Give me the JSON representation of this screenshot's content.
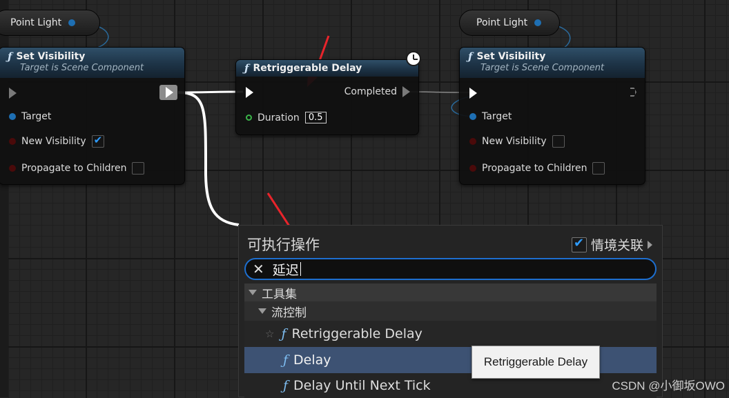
{
  "graph": {
    "var_left": {
      "label": "Point Light"
    },
    "var_right": {
      "label": "Point Light"
    },
    "node_left": {
      "title": "Set Visibility",
      "subtitle": "Target is Scene Component",
      "pins": {
        "target": "Target",
        "new_visibility": "New Visibility",
        "propagate": "Propagate to Children"
      },
      "new_visibility_checked": true,
      "propagate_checked": false
    },
    "node_delay": {
      "title": "Retriggerable Delay",
      "completed": "Completed",
      "duration_label": "Duration",
      "duration_value": "0.5"
    },
    "node_right": {
      "title": "Set Visibility",
      "subtitle": "Target is Scene Component",
      "pins": {
        "target": "Target",
        "new_visibility": "New Visibility",
        "propagate": "Propagate to Children"
      },
      "new_visibility_checked": false,
      "propagate_checked": false
    }
  },
  "action_menu": {
    "title": "可执行操作",
    "context_label": "情境关联",
    "context_checked": true,
    "search_value": "延迟",
    "categories": [
      {
        "label": "工具集"
      },
      {
        "label": "流控制"
      }
    ],
    "items": [
      {
        "label": "Retriggerable Delay",
        "favorite_icon": "star-outline-icon",
        "selected": false
      },
      {
        "label": "Delay",
        "selected": true
      },
      {
        "label": "Delay Until Next Tick",
        "selected": false
      }
    ]
  },
  "tooltip": {
    "text": "Retriggerable Delay"
  },
  "watermark": {
    "text": "CSDN @小御坂OWO"
  },
  "colors": {
    "accent": "#1d6fd0",
    "selected_row": "#3d5273",
    "annotation_arrow": "#e8242b",
    "exec_wire": "#ffffff",
    "object_pin": "#1e6fb3",
    "bool_pin": "#4a0a0a",
    "float_pin": "#3bb54a"
  }
}
